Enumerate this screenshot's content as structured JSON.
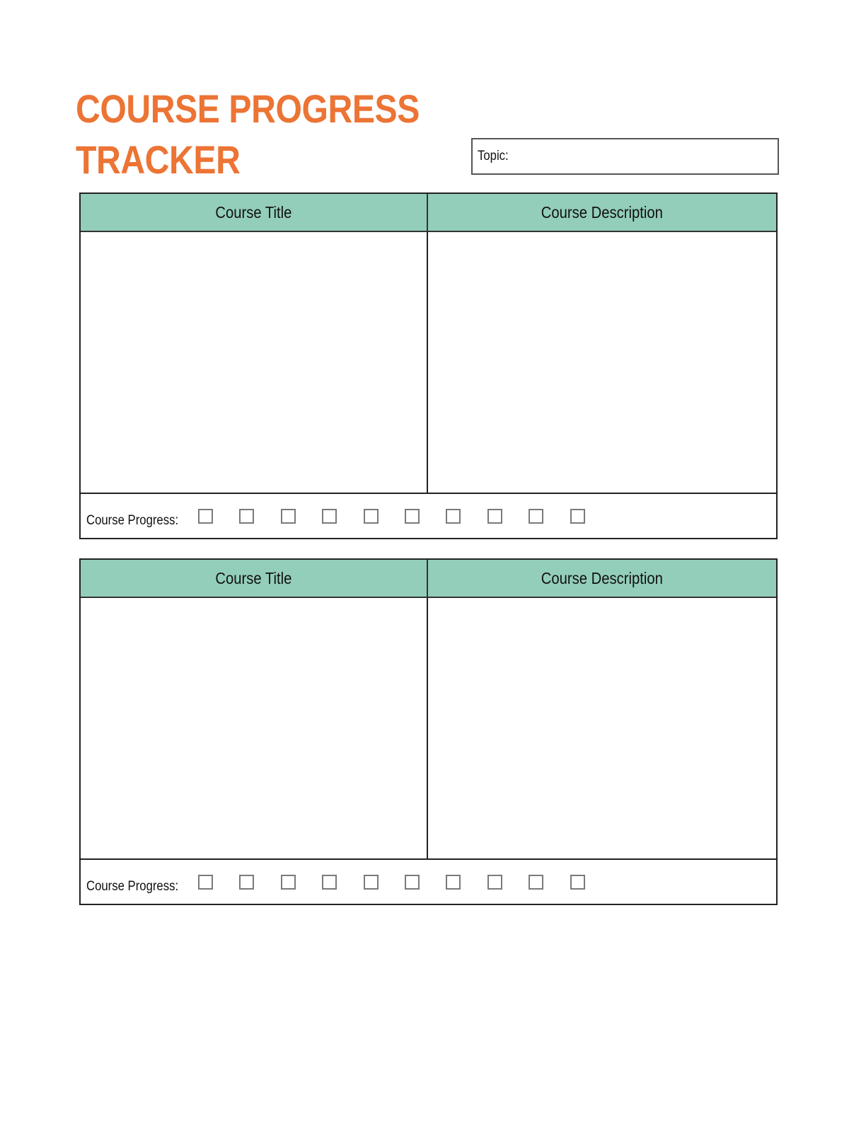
{
  "title": {
    "line1": "COURSE PROGRESS",
    "line2": "TRACKER",
    "color": "#ec7434"
  },
  "topic": {
    "label": "Topic:",
    "value": ""
  },
  "header_color": "#93ceba",
  "cards": [
    {
      "column_headers": [
        "Course Title",
        "Course Description"
      ],
      "course_title": "",
      "course_description": "",
      "progress_label": "Course Progress:",
      "progress_checkboxes": [
        false,
        false,
        false,
        false,
        false,
        false,
        false,
        false,
        false,
        false
      ]
    },
    {
      "column_headers": [
        "Course Title",
        "Course Description"
      ],
      "course_title": "",
      "course_description": "",
      "progress_label": "Course Progress:",
      "progress_checkboxes": [
        false,
        false,
        false,
        false,
        false,
        false,
        false,
        false,
        false,
        false
      ]
    }
  ]
}
